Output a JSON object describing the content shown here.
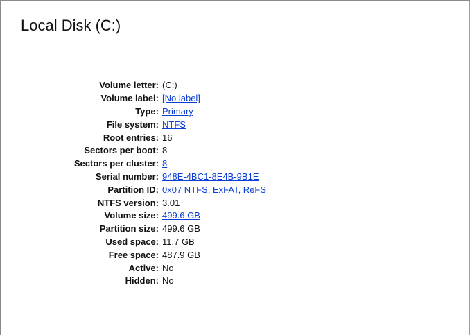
{
  "panel": {
    "title": "Local Disk (C:)"
  },
  "properties": [
    {
      "key": "Volume letter:",
      "value": "(C:)",
      "link": false
    },
    {
      "key": "Volume label:",
      "value": "[No label]",
      "link": true
    },
    {
      "key": "Type:",
      "value": "Primary",
      "link": true
    },
    {
      "key": "File system:",
      "value": "NTFS",
      "link": true
    },
    {
      "key": "Root entries:",
      "value": "16",
      "link": false
    },
    {
      "key": "Sectors per boot:",
      "value": "8",
      "link": false
    },
    {
      "key": "Sectors per cluster:",
      "value": "8",
      "link": true
    },
    {
      "key": "Serial number:",
      "value": "948E-4BC1-8E4B-9B1E",
      "link": true
    },
    {
      "key": "Partition ID:",
      "value": "0x07 NTFS, ExFAT, ReFS",
      "link": true
    },
    {
      "key": "NTFS version:",
      "value": "3.01",
      "link": false
    },
    {
      "key": "Volume size:",
      "value": "499.6 GB",
      "link": true
    },
    {
      "key": "Partition size:",
      "value": "499.6 GB",
      "link": false
    },
    {
      "key": "Used space:",
      "value": "11.7 GB",
      "link": false
    },
    {
      "key": "Free space:",
      "value": "487.9 GB",
      "link": false
    },
    {
      "key": "Active:",
      "value": "No",
      "link": false
    },
    {
      "key": "Hidden:",
      "value": "No",
      "link": false
    }
  ],
  "colors": {
    "link": "#0a3ed6",
    "text": "#111111",
    "rule": "#bdbdbd"
  }
}
